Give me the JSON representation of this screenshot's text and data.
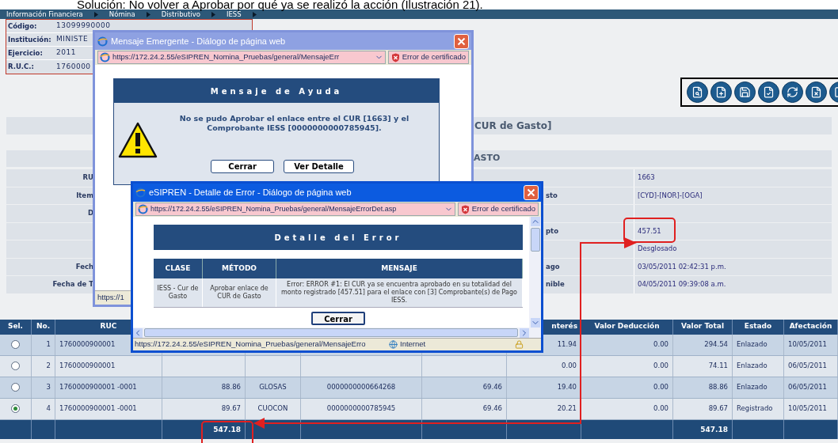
{
  "caption": "Solución: No volver a Aprobar por qué ya se realizó la acción (Ilustración 21).",
  "breadcrumb": [
    "Información Financiera",
    "Nómina",
    "Distributivo",
    "IESS"
  ],
  "info": [
    {
      "label": "Código:",
      "value": "13099990000"
    },
    {
      "label": "Institución:",
      "value": "MINISTE"
    },
    {
      "label": "Ejercicio:",
      "value": "2011"
    },
    {
      "label": "R.U.C.:",
      "value": "1760000"
    }
  ],
  "form": {
    "title": "CUR de Gasto]",
    "section": "ASTO",
    "rows": [
      {
        "left_label": "RU",
        "value": "1663"
      },
      {
        "left_label": "Item",
        "right_label": "sto",
        "value": "[CYD]-[NOR]-[OGA]"
      },
      {
        "left_label": "D"
      },
      {
        "right_label": "pto",
        "value": "457.51"
      },
      {
        "value": "Desglosado"
      },
      {
        "left_label": "Fech",
        "right_label": "ago",
        "value": "03/05/2011 02:42:31 p.m."
      },
      {
        "left_label": "Fecha de T",
        "right_label": "nible",
        "value": "04/05/2011 09:39:08 a.m."
      }
    ]
  },
  "table": {
    "columns": {
      "sel": "Sel.",
      "no": "No.",
      "ruc": "RUC",
      "interes": "nterés",
      "deduccion": "Valor Deducción",
      "total": "Valor Total",
      "estado": "Estado",
      "afectacion": "Afectación"
    },
    "rows": [
      {
        "selected": false,
        "no": "1",
        "ruc": "1760000900001",
        "interes": "11.94",
        "deduccion": "0.00",
        "total": "294.54",
        "estado": "Enlazado",
        "afectacion": "10/05/2011"
      },
      {
        "selected": false,
        "no": "2",
        "ruc": "1760000900001",
        "interes": "0.00",
        "deduccion": "0.00",
        "total": "74.11",
        "estado": "Enlazado",
        "afectacion": "06/05/2011"
      },
      {
        "selected": false,
        "no": "3",
        "ruc": "1760000900001 -0001",
        "column_4": "88.86",
        "column_5": "GLOSAS",
        "column_6": "0000000000664268",
        "column_7": "69.46",
        "interes": "19.40",
        "deduccion": "0.00",
        "total": "88.86",
        "estado": "Enlazado",
        "afectacion": "06/05/2011"
      },
      {
        "selected": true,
        "no": "4",
        "ruc": "1760000900001 -0001",
        "column_4": "89.67",
        "column_5": "CUOCON",
        "column_6": "0000000000785945",
        "column_7": "69.46",
        "interes": "20.21",
        "deduccion": "0.00",
        "total": "89.67",
        "estado": "Registrado",
        "afectacion": "10/05/2011"
      }
    ],
    "footer": {
      "column_4": "547.18",
      "total": "547.18"
    }
  },
  "help_dialog": {
    "title": "Mensaje Emergente - Diálogo de página web",
    "url": "https://172.24.2.55/eSIPREN_Nomina_Pruebas/general/MensajeErr",
    "cert_error": "Error de certificado",
    "heading": "Mensaje de Ayuda",
    "message": "No se pudo Aprobar el enlace entre el CUR [1663] y el Comprobante IESS [0000000000785945].",
    "buttons": [
      "Cerrar",
      "Ver Detalle"
    ],
    "status": "https://1"
  },
  "error_dialog": {
    "title": "eSIPREN - Detalle de Error - Diálogo de página web",
    "url": "https://172.24.2.55/eSIPREN_Nomina_Pruebas/general/MensajeErrorDet.asp",
    "cert_error": "Error de certificado",
    "heading": "Detalle del Error",
    "columns": [
      "CLASE",
      "MÉTODO",
      "MENSAJE"
    ],
    "row": [
      "IESS - Cur de Gasto",
      "Aprobar enlace de CUR de Gasto",
      "Error: ERROR #1: El CUR ya se encuentra aprobado en su totalidad del monto registrado [457.51] para el enlace con [3] Comprobante(s) de Pago IESS."
    ],
    "button": "Cerrar",
    "status": "https://172.24.2.55/eSIPREN_Nomina_Pruebas/general/MensajeErro",
    "zone": "Internet"
  }
}
